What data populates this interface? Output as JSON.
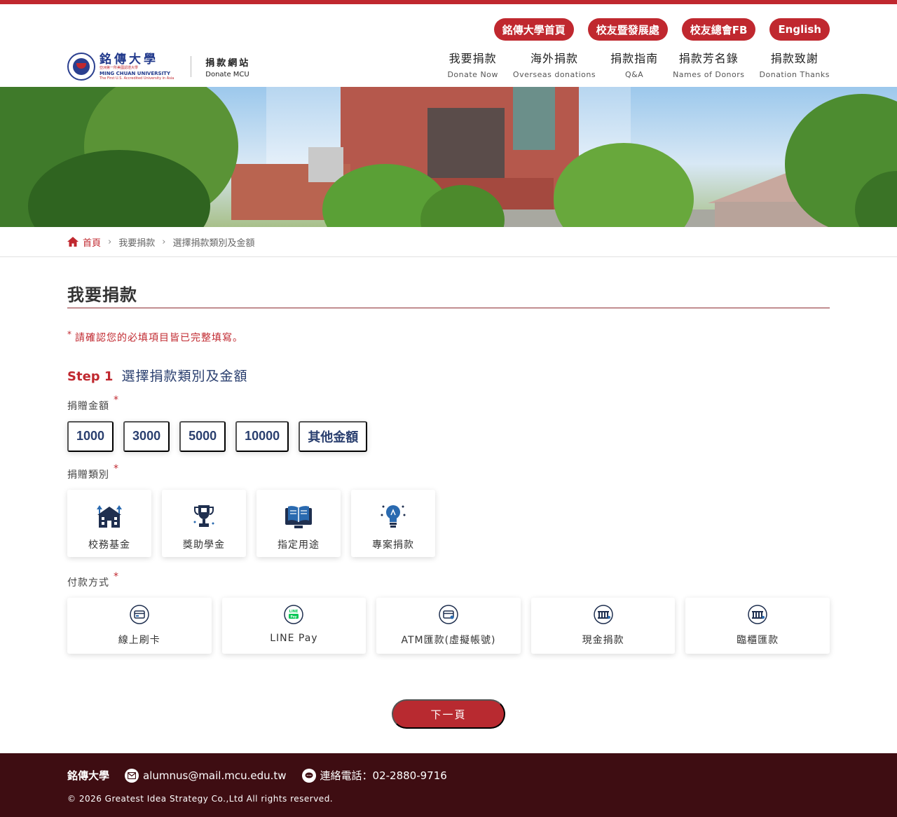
{
  "header": {
    "logo": {
      "name_cn": "銘傳大學",
      "subtitle_cn": "亞洲第一所美國認證大學",
      "name_en": "MING CHUAN UNIVERSITY",
      "tagline_en": "The First U.S. Accredited University in Asia"
    },
    "site": {
      "name_cn": "捐款網站",
      "name_en": "Donate MCU"
    },
    "quick_links": [
      "銘傳大學首頁",
      "校友暨發展處",
      "校友總會FB",
      "English"
    ],
    "nav": [
      {
        "cn": "我要捐款",
        "en": "Donate Now"
      },
      {
        "cn": "海外捐款",
        "en": "Overseas donations"
      },
      {
        "cn": "捐款指南",
        "en": "Q&A"
      },
      {
        "cn": "捐款芳名錄",
        "en": "Names of Donors"
      },
      {
        "cn": "捐款致謝",
        "en": "Donation Thanks"
      }
    ]
  },
  "breadcrumb": {
    "home": "首頁",
    "level1": "我要捐款",
    "level2": "選擇捐款類別及金額"
  },
  "main": {
    "title": "我要捐款",
    "notice": "請確認您的必填項目皆已完整填寫。",
    "step": {
      "number": "Step 1",
      "title": "選擇捐款類別及金額"
    },
    "amount": {
      "label": "捐贈金額",
      "options": [
        "1000",
        "3000",
        "5000",
        "10000",
        "其他金額"
      ]
    },
    "category": {
      "label": "捐贈類別",
      "options": [
        {
          "label": "校務基金",
          "icon": "school-building-icon"
        },
        {
          "label": "獎助學金",
          "icon": "trophy-icon"
        },
        {
          "label": "指定用途",
          "icon": "book-icon"
        },
        {
          "label": "專案捐款",
          "icon": "lightbulb-icon"
        }
      ]
    },
    "payment": {
      "label": "付款方式",
      "options": [
        {
          "label": "線上刷卡",
          "icon": "credit-card-icon"
        },
        {
          "label": "LINE Pay",
          "icon": "line-pay-icon"
        },
        {
          "label": "ATM匯款(虛擬帳號)",
          "icon": "atm-card-icon"
        },
        {
          "label": "現金捐款",
          "icon": "bank-icon"
        },
        {
          "label": "臨櫃匯款",
          "icon": "bank-counter-icon"
        }
      ]
    },
    "next_label": "下一頁"
  },
  "footer": {
    "name": "銘傳大學",
    "email": "alumnus@mail.mcu.edu.tw",
    "phone": "連絡電話：02-2880-9716",
    "copyright": "© 2026 Greatest Idea Strategy Co.,Ltd All rights reserved."
  },
  "colors": {
    "brand": "#c0282f",
    "navy": "#2a3f6f",
    "footer": "#3e0d12"
  }
}
